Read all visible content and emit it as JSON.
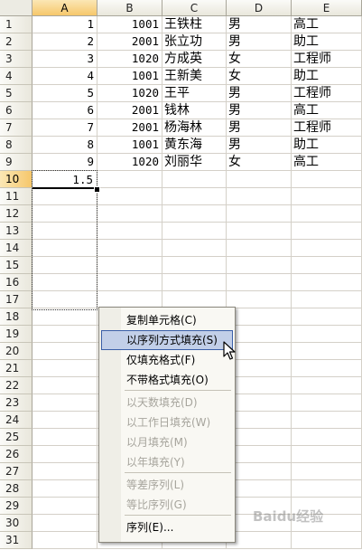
{
  "columns": [
    "A",
    "B",
    "C",
    "D",
    "E"
  ],
  "rows": [
    "1",
    "2",
    "3",
    "4",
    "5",
    "6",
    "7",
    "8",
    "9",
    "10",
    "11",
    "12",
    "13",
    "14",
    "15",
    "16",
    "17",
    "18",
    "19",
    "20",
    "21",
    "22",
    "23",
    "24",
    "25",
    "26",
    "27",
    "28",
    "29",
    "30",
    "31"
  ],
  "data": [
    {
      "a": "1",
      "b": "1001",
      "c": "王铁柱",
      "d": "男",
      "e": "高工"
    },
    {
      "a": "2",
      "b": "2001",
      "c": "张立功",
      "d": "男",
      "e": "助工"
    },
    {
      "a": "3",
      "b": "1020",
      "c": "方成英",
      "d": "女",
      "e": "工程师"
    },
    {
      "a": "4",
      "b": "1001",
      "c": "王新美",
      "d": "女",
      "e": "助工"
    },
    {
      "a": "5",
      "b": "1020",
      "c": "王平",
      "d": "男",
      "e": "工程师"
    },
    {
      "a": "6",
      "b": "2001",
      "c": "钱林",
      "d": "男",
      "e": "高工"
    },
    {
      "a": "7",
      "b": "2001",
      "c": "杨海林",
      "d": "男",
      "e": "工程师"
    },
    {
      "a": "8",
      "b": "1001",
      "c": "黄东海",
      "d": "男",
      "e": "助工"
    },
    {
      "a": "9",
      "b": "1020",
      "c": "刘丽华",
      "d": "女",
      "e": "高工"
    }
  ],
  "active_value": "1.5",
  "menu": {
    "items": [
      {
        "label": "复制单元格(C)",
        "disabled": false,
        "highlighted": false
      },
      {
        "label": "以序列方式填充(S)",
        "disabled": false,
        "highlighted": true
      },
      {
        "label": "仅填充格式(F)",
        "disabled": false,
        "highlighted": false
      },
      {
        "label": "不带格式填充(O)",
        "disabled": false,
        "highlighted": false
      },
      {
        "label": "以天数填充(D)",
        "disabled": true,
        "highlighted": false
      },
      {
        "label": "以工作日填充(W)",
        "disabled": true,
        "highlighted": false
      },
      {
        "label": "以月填充(M)",
        "disabled": true,
        "highlighted": false
      },
      {
        "label": "以年填充(Y)",
        "disabled": true,
        "highlighted": false
      },
      {
        "label": "等差序列(L)",
        "disabled": true,
        "highlighted": false
      },
      {
        "label": "等比序列(G)",
        "disabled": true,
        "highlighted": false
      },
      {
        "label": "序列(E)...",
        "disabled": false,
        "highlighted": false
      }
    ]
  },
  "watermark": "Baidu经验"
}
